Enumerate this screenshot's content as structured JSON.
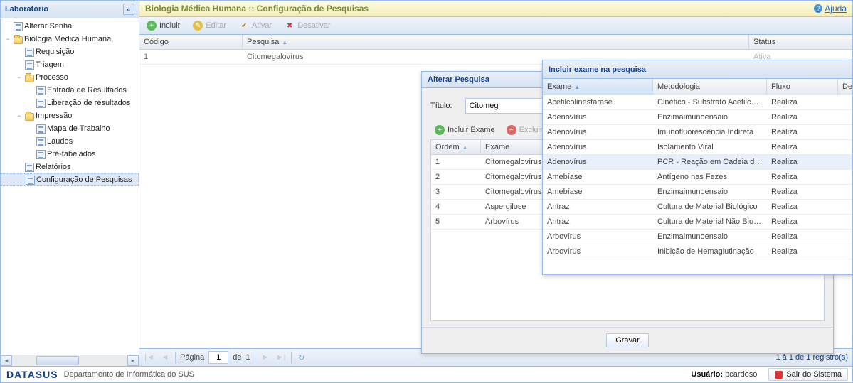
{
  "sidebar": {
    "title": "Laboratório",
    "nodes": [
      {
        "label": "Alterar Senha",
        "indent": 0,
        "leaf": true,
        "tw": ""
      },
      {
        "label": "Biologia Médica Humana",
        "indent": 0,
        "leaf": false,
        "tw": "−"
      },
      {
        "label": "Requisição",
        "indent": 1,
        "leaf": true,
        "tw": ""
      },
      {
        "label": "Triagem",
        "indent": 1,
        "leaf": true,
        "tw": ""
      },
      {
        "label": "Processo",
        "indent": 1,
        "leaf": false,
        "tw": "−"
      },
      {
        "label": "Entrada de Resultados",
        "indent": 2,
        "leaf": true,
        "tw": ""
      },
      {
        "label": "Liberação de resultados",
        "indent": 2,
        "leaf": true,
        "tw": ""
      },
      {
        "label": "Impressão",
        "indent": 1,
        "leaf": false,
        "tw": "−"
      },
      {
        "label": "Mapa de Trabalho",
        "indent": 2,
        "leaf": true,
        "tw": ""
      },
      {
        "label": "Laudos",
        "indent": 2,
        "leaf": true,
        "tw": ""
      },
      {
        "label": "Pré-tabelados",
        "indent": 2,
        "leaf": true,
        "tw": ""
      },
      {
        "label": "Relatórios",
        "indent": 1,
        "leaf": true,
        "tw": ""
      },
      {
        "label": "Configuração de Pesquisas",
        "indent": 1,
        "leaf": true,
        "tw": "",
        "selected": true
      }
    ]
  },
  "main": {
    "title": "Biologia Médica Humana :: Configuração de Pesquisas",
    "help": "Ajuda",
    "toolbar": {
      "incluir": "Incluir",
      "editar": "Editar",
      "ativar": "Ativar",
      "desativar": "Desativar"
    },
    "columns": {
      "codigo": "Código",
      "pesquisa": "Pesquisa",
      "status": "Status"
    },
    "row": {
      "codigo": "1",
      "pesquisa": "Citomegalovírus",
      "status": "Ativa"
    },
    "paging": {
      "pagina_label": "Página",
      "de_label": "de",
      "page": "1",
      "total": "1",
      "info": "1 à 1 de 1 registro(s)"
    }
  },
  "alterar": {
    "title": "Alterar Pesquisa",
    "titulo_label": "Título:",
    "titulo_value": "Citomeg",
    "incluir_exame": "Incluir Exame",
    "excluir": "Excluir",
    "col_ordem": "Ordem",
    "col_exame": "Exame",
    "rows": [
      {
        "ordem": "1",
        "exame": "Citomegalovírus"
      },
      {
        "ordem": "2",
        "exame": "Citomegalovírus"
      },
      {
        "ordem": "3",
        "exame": "Citomegalovírus"
      },
      {
        "ordem": "4",
        "exame": "Aspergilose"
      },
      {
        "ordem": "5",
        "exame": "Arbovírus"
      }
    ],
    "gravar": "Gravar"
  },
  "incluir": {
    "title": "Incluir exame na pesquisa",
    "cols": {
      "exame": "Exame",
      "metodologia": "Metodologia",
      "fluxo": "Fluxo",
      "destino": "Destino"
    },
    "rows": [
      {
        "exame": "Acetilcolinestarase",
        "met": "Cinético - Substrato Acetilcolina",
        "fluxo": "Realiza",
        "dest": "",
        "hov": false
      },
      {
        "exame": "Adenovírus",
        "met": "Enzimaimunoensaio",
        "fluxo": "Realiza",
        "dest": "",
        "hov": false
      },
      {
        "exame": "Adenovírus",
        "met": "Imunofluorescência Indireta",
        "fluxo": "Realiza",
        "dest": "",
        "hov": false
      },
      {
        "exame": "Adenovírus",
        "met": "Isolamento Viral",
        "fluxo": "Realiza",
        "dest": "",
        "hov": false
      },
      {
        "exame": "Adenovírus",
        "met": "PCR - Reação em Cadeia de Poli",
        "fluxo": "Realiza",
        "dest": "",
        "hov": true
      },
      {
        "exame": "Amebíase",
        "met": "Antígeno nas Fezes",
        "fluxo": "Realiza",
        "dest": "",
        "hov": false
      },
      {
        "exame": "Amebíase",
        "met": "Enzimaimunoensaio",
        "fluxo": "Realiza",
        "dest": "",
        "hov": false
      },
      {
        "exame": "Antraz",
        "met": "Cultura de Material Biológico",
        "fluxo": "Realiza",
        "dest": "",
        "hov": false
      },
      {
        "exame": "Antraz",
        "met": "Cultura de Material Não Biológico",
        "fluxo": "Realiza",
        "dest": "",
        "hov": false
      },
      {
        "exame": "Arbovírus",
        "met": "Enzimaimunoensaio",
        "fluxo": "Realiza",
        "dest": "",
        "hov": false
      },
      {
        "exame": "Arbovírus",
        "met": "Inibição de Hemaglutinação",
        "fluxo": "Realiza",
        "dest": "",
        "hov": false
      }
    ]
  },
  "footer": {
    "brand": "DATASUS",
    "dept": "Departamento de Informática do SUS",
    "user_label": "Usuário:",
    "user": "pcardoso",
    "exit": "Sair do Sistema"
  }
}
